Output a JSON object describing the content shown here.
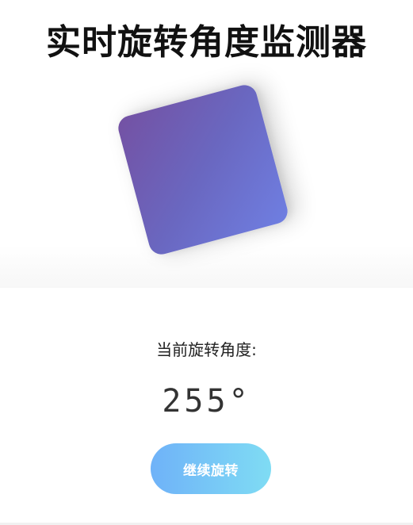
{
  "header": {
    "title": "实时旋转角度监测器"
  },
  "shape": {
    "rotation_deg": 255,
    "gradient": [
      "#7380e6",
      "#6b62bb",
      "#7451a3"
    ]
  },
  "readout": {
    "label": "当前旋转角度:",
    "angle_text": "255°"
  },
  "controls": {
    "continue_label": "继续旋转",
    "button_gradient": [
      "#6fb2f8",
      "#7fdcf4"
    ]
  }
}
